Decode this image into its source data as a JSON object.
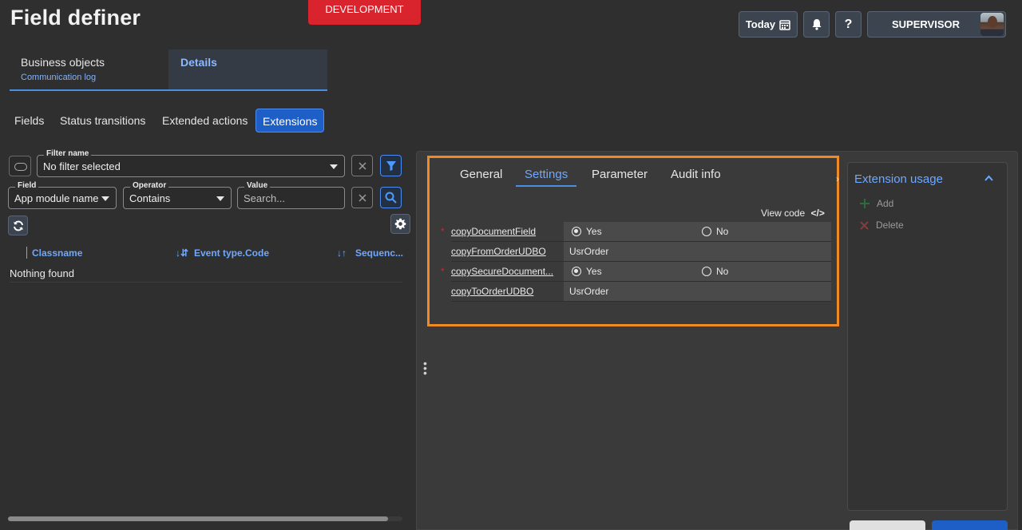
{
  "header": {
    "title": "Field definer",
    "environment": "DEVELOPMENT",
    "today_label": "Today",
    "help_label": "?",
    "user_label": "SUPERVISOR"
  },
  "top_tabs": {
    "business_objects": "Business objects",
    "business_objects_sub": "Communication log",
    "details": "Details"
  },
  "sub_tabs": [
    "Fields",
    "Status transitions",
    "Extended actions",
    "Extensions"
  ],
  "filter": {
    "filter_name_label": "Filter name",
    "filter_name_value": "No filter selected",
    "field_label": "Field",
    "field_value": "App module name",
    "operator_label": "Operator",
    "operator_value": "Contains",
    "value_label": "Value",
    "value_placeholder": "Search..."
  },
  "grid": {
    "columns": [
      "Classname",
      "Event type.Code",
      "Sequenc..."
    ],
    "empty_text": "Nothing found"
  },
  "settings_tabs": [
    "General",
    "Settings",
    "Parameter",
    "Audit info"
  ],
  "view_code_label": "View code",
  "view_code_icon": "</>",
  "parameters": [
    {
      "name": "copyDocumentField",
      "required": true,
      "type": "radio",
      "options": [
        "Yes",
        "No"
      ],
      "selected": "Yes"
    },
    {
      "name": "copyFromOrderUDBO",
      "required": false,
      "type": "text",
      "value": "UsrOrder"
    },
    {
      "name": "copySecureDocument...",
      "required": true,
      "type": "radio",
      "options": [
        "Yes",
        "No"
      ],
      "selected": "Yes"
    },
    {
      "name": "copyToOrderUDBO",
      "required": false,
      "type": "text",
      "value": "UsrOrder"
    }
  ],
  "required_marker": "*",
  "extension_usage": {
    "title": "Extension usage",
    "add_label": "Add",
    "delete_label": "Delete"
  },
  "colors": {
    "accent": "#1e5fc7",
    "link": "#6ea8ff",
    "highlight_frame": "#f08a24",
    "env_badge": "#d9232d"
  }
}
